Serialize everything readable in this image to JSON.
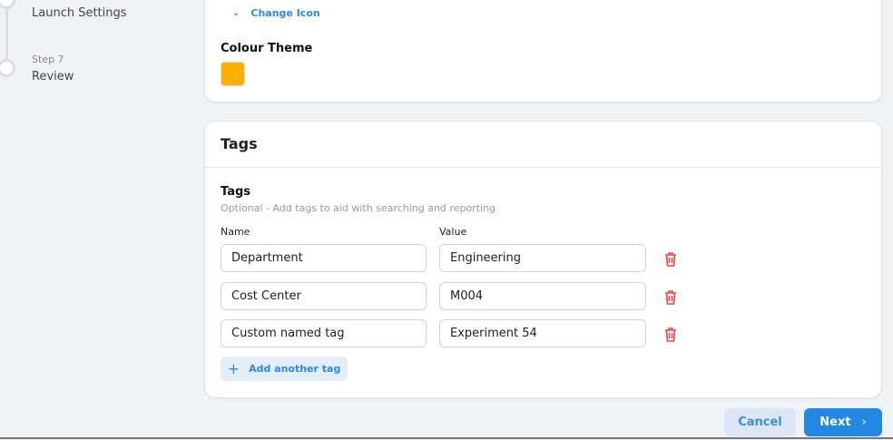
{
  "stepper": {
    "steps": [
      {
        "label": "Launch Settings"
      },
      {
        "step": "Step 7",
        "label": "Review"
      }
    ]
  },
  "appearance": {
    "change_icon": "Change Icon",
    "colour_theme_label": "Colour Theme",
    "colour_theme_value": "#fbb000"
  },
  "tags_card": {
    "title": "Tags",
    "section_label": "Tags",
    "help": "Optional - Add tags to aid with searching and reporting",
    "col_name": "Name",
    "col_value": "Value",
    "rows": [
      {
        "name": "Department",
        "value": "Engineering"
      },
      {
        "name": "Cost Center",
        "value": "M004"
      },
      {
        "name": "Custom named tag",
        "value": "Experiment 54"
      }
    ],
    "add_label": "Add another tag"
  },
  "footer": {
    "cancel": "Cancel",
    "next": "Next"
  },
  "colors": {
    "accent": "#2288e3",
    "danger": "#ee4444"
  }
}
